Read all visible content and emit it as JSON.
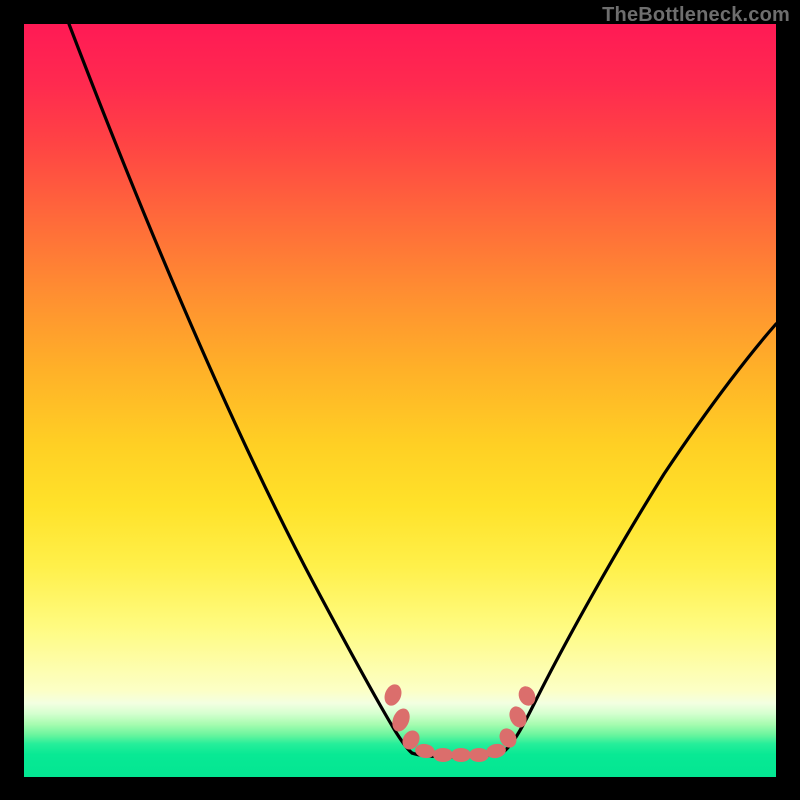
{
  "watermark": "TheBottleneck.com",
  "chart_data": {
    "type": "line",
    "title": "",
    "xlabel": "",
    "ylabel": "",
    "xlim": [
      0,
      100
    ],
    "ylim": [
      0,
      100
    ],
    "grid": false,
    "left_curve": [
      {
        "x": 6,
        "y": 100
      },
      {
        "x": 15,
        "y": 80
      },
      {
        "x": 24,
        "y": 60
      },
      {
        "x": 33,
        "y": 40
      },
      {
        "x": 42,
        "y": 20
      },
      {
        "x": 46,
        "y": 10
      },
      {
        "x": 49,
        "y": 5
      },
      {
        "x": 51,
        "y": 3
      }
    ],
    "right_curve": [
      {
        "x": 64,
        "y": 3
      },
      {
        "x": 66,
        "y": 5
      },
      {
        "x": 69,
        "y": 10
      },
      {
        "x": 74,
        "y": 20
      },
      {
        "x": 83,
        "y": 36
      },
      {
        "x": 92,
        "y": 50
      },
      {
        "x": 100,
        "y": 62
      }
    ],
    "flat_bottom": [
      {
        "x": 51,
        "y": 3
      },
      {
        "x": 64,
        "y": 3
      }
    ],
    "markers": [
      {
        "x": 49,
        "y": 11
      },
      {
        "x": 50,
        "y": 7.5
      },
      {
        "x": 51,
        "y": 5
      },
      {
        "x": 53,
        "y": 3.2
      },
      {
        "x": 55.5,
        "y": 3
      },
      {
        "x": 58,
        "y": 3
      },
      {
        "x": 60.5,
        "y": 3
      },
      {
        "x": 62.8,
        "y": 3.2
      },
      {
        "x": 64.2,
        "y": 5.2
      },
      {
        "x": 65.6,
        "y": 8
      },
      {
        "x": 67,
        "y": 11
      }
    ]
  }
}
